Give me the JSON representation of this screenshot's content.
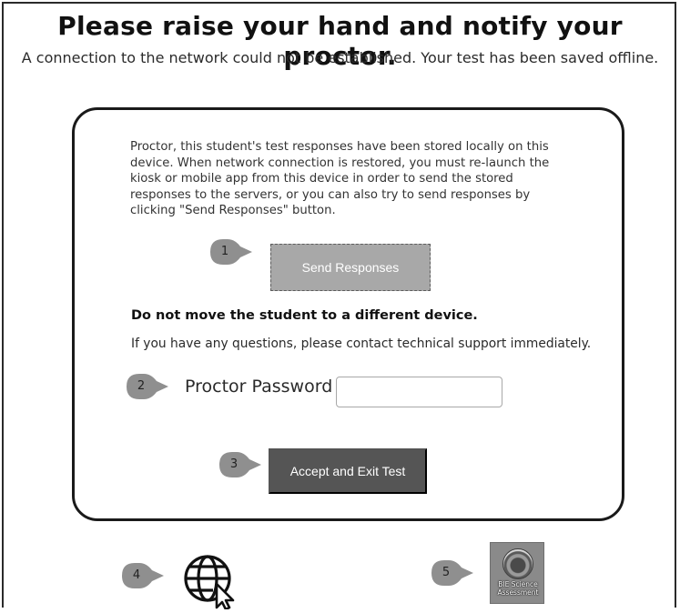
{
  "header": {
    "title": "Please raise your hand and notify your proctor.",
    "subtitle": "A connection to the network could not be established. Your test has been saved offline."
  },
  "panel": {
    "note": "Proctor, this student's test responses have been stored locally on this device. When network connection is restored, you must re-launch the kiosk or mobile app from this device in order to send the stored responses to the servers, or you can also try to send responses by clicking \"Send Responses\" button.",
    "send_button_label": "Send Responses",
    "warning": "Do not move the student to a different device.",
    "contact": "If you have any questions, please contact technical support immediately.",
    "password_label": "Proctor Password",
    "password_value": "",
    "accept_button_label": "Accept and Exit Test"
  },
  "markers": [
    "1",
    "2",
    "3",
    "4",
    "5"
  ],
  "desktop": {
    "globe_icon": "globe-cursor-icon",
    "app_icon": "science-assessment-app-icon",
    "app_label": "BIE Science Assessment"
  },
  "colors": {
    "marker_fill": "#8f8f8f",
    "send_button_bg": "#a8a8a8",
    "accept_button_bg": "#555555"
  }
}
